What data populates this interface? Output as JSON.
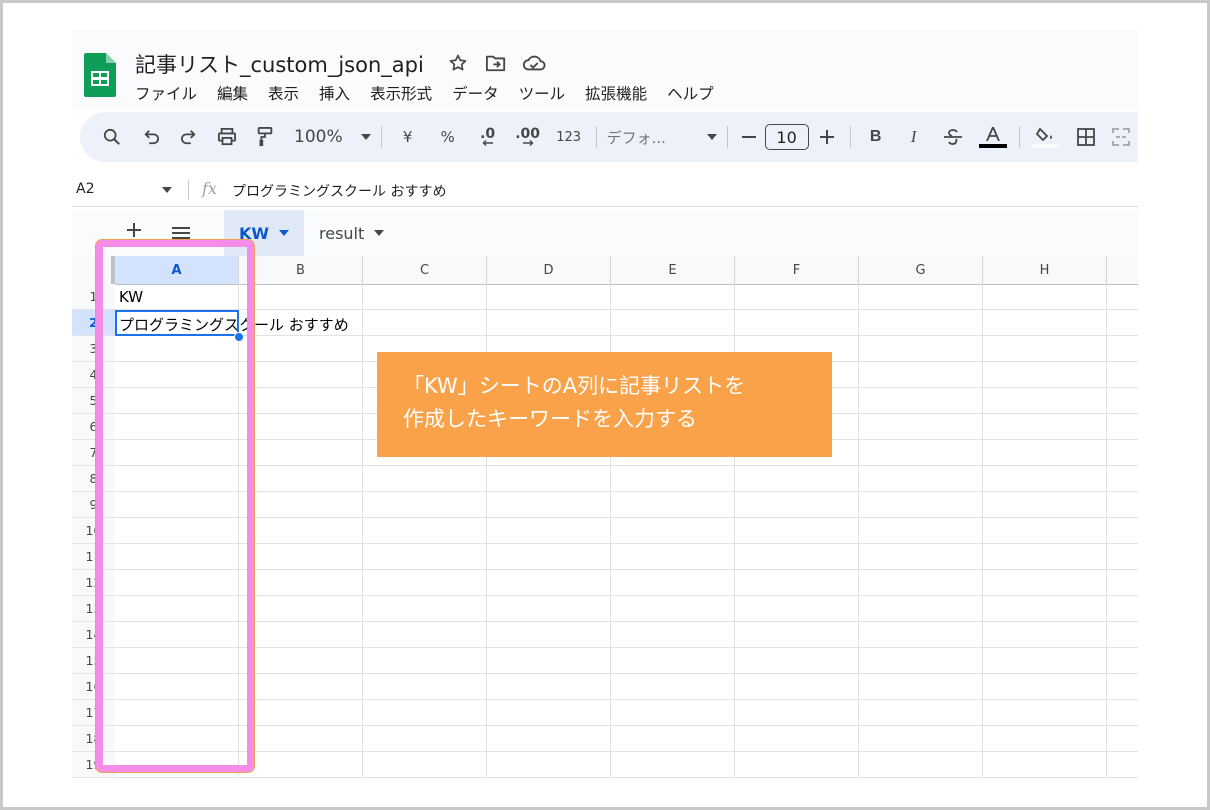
{
  "doc": {
    "title": "記事リスト_custom_json_api"
  },
  "menu": [
    "ファイル",
    "編集",
    "表示",
    "挿入",
    "表示形式",
    "データ",
    "ツール",
    "拡張機能",
    "ヘルプ"
  ],
  "toolbar": {
    "zoom": "100%",
    "currency": "¥",
    "percent": "%",
    "dec_decrease": ".0",
    "dec_increase": ".00",
    "number_format": "123",
    "font": "デフォ...",
    "font_size": "10"
  },
  "formula_bar": {
    "name_box": "A2",
    "fx": "fx",
    "content": "プログラミングスクール おすすめ"
  },
  "sheets": [
    {
      "label": "KW",
      "active": true
    },
    {
      "label": "result",
      "active": false
    }
  ],
  "columns": [
    "A",
    "B",
    "C",
    "D",
    "E",
    "F",
    "G",
    "H"
  ],
  "rows": [
    "1",
    "2",
    "3",
    "4",
    "5",
    "6",
    "7",
    "8",
    "9",
    "10",
    "11",
    "12",
    "13",
    "14",
    "15",
    "16",
    "17",
    "18",
    "19"
  ],
  "cells": {
    "A1": "KW",
    "A2": "プログラミングスクール おすすめ"
  },
  "callout": {
    "text": "「KW」シートのA列に記事リストを\n作成したキーワードを入力する"
  },
  "colors": {
    "accent": "#0b57d0",
    "highlight": "#f58ce8",
    "callout": "#f9a24a",
    "sheets_green": "#0f9d58"
  }
}
